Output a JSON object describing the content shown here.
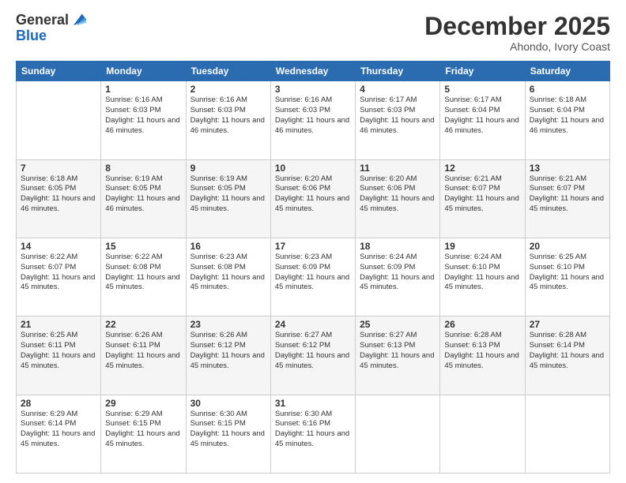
{
  "header": {
    "logo": {
      "general": "General",
      "blue": "Blue"
    },
    "title": "December 2025",
    "subtitle": "Ahondo, Ivory Coast"
  },
  "calendar": {
    "days_of_week": [
      "Sunday",
      "Monday",
      "Tuesday",
      "Wednesday",
      "Thursday",
      "Friday",
      "Saturday"
    ],
    "weeks": [
      [
        {
          "day": "",
          "sunrise": "",
          "sunset": "",
          "daylight": ""
        },
        {
          "day": "1",
          "sunrise": "Sunrise: 6:16 AM",
          "sunset": "Sunset: 6:03 PM",
          "daylight": "Daylight: 11 hours and 46 minutes."
        },
        {
          "day": "2",
          "sunrise": "Sunrise: 6:16 AM",
          "sunset": "Sunset: 6:03 PM",
          "daylight": "Daylight: 11 hours and 46 minutes."
        },
        {
          "day": "3",
          "sunrise": "Sunrise: 6:16 AM",
          "sunset": "Sunset: 6:03 PM",
          "daylight": "Daylight: 11 hours and 46 minutes."
        },
        {
          "day": "4",
          "sunrise": "Sunrise: 6:17 AM",
          "sunset": "Sunset: 6:03 PM",
          "daylight": "Daylight: 11 hours and 46 minutes."
        },
        {
          "day": "5",
          "sunrise": "Sunrise: 6:17 AM",
          "sunset": "Sunset: 6:04 PM",
          "daylight": "Daylight: 11 hours and 46 minutes."
        },
        {
          "day": "6",
          "sunrise": "Sunrise: 6:18 AM",
          "sunset": "Sunset: 6:04 PM",
          "daylight": "Daylight: 11 hours and 46 minutes."
        }
      ],
      [
        {
          "day": "7",
          "sunrise": "Sunrise: 6:18 AM",
          "sunset": "Sunset: 6:05 PM",
          "daylight": "Daylight: 11 hours and 46 minutes."
        },
        {
          "day": "8",
          "sunrise": "Sunrise: 6:19 AM",
          "sunset": "Sunset: 6:05 PM",
          "daylight": "Daylight: 11 hours and 46 minutes."
        },
        {
          "day": "9",
          "sunrise": "Sunrise: 6:19 AM",
          "sunset": "Sunset: 6:05 PM",
          "daylight": "Daylight: 11 hours and 45 minutes."
        },
        {
          "day": "10",
          "sunrise": "Sunrise: 6:20 AM",
          "sunset": "Sunset: 6:06 PM",
          "daylight": "Daylight: 11 hours and 45 minutes."
        },
        {
          "day": "11",
          "sunrise": "Sunrise: 6:20 AM",
          "sunset": "Sunset: 6:06 PM",
          "daylight": "Daylight: 11 hours and 45 minutes."
        },
        {
          "day": "12",
          "sunrise": "Sunrise: 6:21 AM",
          "sunset": "Sunset: 6:07 PM",
          "daylight": "Daylight: 11 hours and 45 minutes."
        },
        {
          "day": "13",
          "sunrise": "Sunrise: 6:21 AM",
          "sunset": "Sunset: 6:07 PM",
          "daylight": "Daylight: 11 hours and 45 minutes."
        }
      ],
      [
        {
          "day": "14",
          "sunrise": "Sunrise: 6:22 AM",
          "sunset": "Sunset: 6:07 PM",
          "daylight": "Daylight: 11 hours and 45 minutes."
        },
        {
          "day": "15",
          "sunrise": "Sunrise: 6:22 AM",
          "sunset": "Sunset: 6:08 PM",
          "daylight": "Daylight: 11 hours and 45 minutes."
        },
        {
          "day": "16",
          "sunrise": "Sunrise: 6:23 AM",
          "sunset": "Sunset: 6:08 PM",
          "daylight": "Daylight: 11 hours and 45 minutes."
        },
        {
          "day": "17",
          "sunrise": "Sunrise: 6:23 AM",
          "sunset": "Sunset: 6:09 PM",
          "daylight": "Daylight: 11 hours and 45 minutes."
        },
        {
          "day": "18",
          "sunrise": "Sunrise: 6:24 AM",
          "sunset": "Sunset: 6:09 PM",
          "daylight": "Daylight: 11 hours and 45 minutes."
        },
        {
          "day": "19",
          "sunrise": "Sunrise: 6:24 AM",
          "sunset": "Sunset: 6:10 PM",
          "daylight": "Daylight: 11 hours and 45 minutes."
        },
        {
          "day": "20",
          "sunrise": "Sunrise: 6:25 AM",
          "sunset": "Sunset: 6:10 PM",
          "daylight": "Daylight: 11 hours and 45 minutes."
        }
      ],
      [
        {
          "day": "21",
          "sunrise": "Sunrise: 6:25 AM",
          "sunset": "Sunset: 6:11 PM",
          "daylight": "Daylight: 11 hours and 45 minutes."
        },
        {
          "day": "22",
          "sunrise": "Sunrise: 6:26 AM",
          "sunset": "Sunset: 6:11 PM",
          "daylight": "Daylight: 11 hours and 45 minutes."
        },
        {
          "day": "23",
          "sunrise": "Sunrise: 6:26 AM",
          "sunset": "Sunset: 6:12 PM",
          "daylight": "Daylight: 11 hours and 45 minutes."
        },
        {
          "day": "24",
          "sunrise": "Sunrise: 6:27 AM",
          "sunset": "Sunset: 6:12 PM",
          "daylight": "Daylight: 11 hours and 45 minutes."
        },
        {
          "day": "25",
          "sunrise": "Sunrise: 6:27 AM",
          "sunset": "Sunset: 6:13 PM",
          "daylight": "Daylight: 11 hours and 45 minutes."
        },
        {
          "day": "26",
          "sunrise": "Sunrise: 6:28 AM",
          "sunset": "Sunset: 6:13 PM",
          "daylight": "Daylight: 11 hours and 45 minutes."
        },
        {
          "day": "27",
          "sunrise": "Sunrise: 6:28 AM",
          "sunset": "Sunset: 6:14 PM",
          "daylight": "Daylight: 11 hours and 45 minutes."
        }
      ],
      [
        {
          "day": "28",
          "sunrise": "Sunrise: 6:29 AM",
          "sunset": "Sunset: 6:14 PM",
          "daylight": "Daylight: 11 hours and 45 minutes."
        },
        {
          "day": "29",
          "sunrise": "Sunrise: 6:29 AM",
          "sunset": "Sunset: 6:15 PM",
          "daylight": "Daylight: 11 hours and 45 minutes."
        },
        {
          "day": "30",
          "sunrise": "Sunrise: 6:30 AM",
          "sunset": "Sunset: 6:15 PM",
          "daylight": "Daylight: 11 hours and 45 minutes."
        },
        {
          "day": "31",
          "sunrise": "Sunrise: 6:30 AM",
          "sunset": "Sunset: 6:16 PM",
          "daylight": "Daylight: 11 hours and 45 minutes."
        },
        {
          "day": "",
          "sunrise": "",
          "sunset": "",
          "daylight": ""
        },
        {
          "day": "",
          "sunrise": "",
          "sunset": "",
          "daylight": ""
        },
        {
          "day": "",
          "sunrise": "",
          "sunset": "",
          "daylight": ""
        }
      ]
    ]
  }
}
